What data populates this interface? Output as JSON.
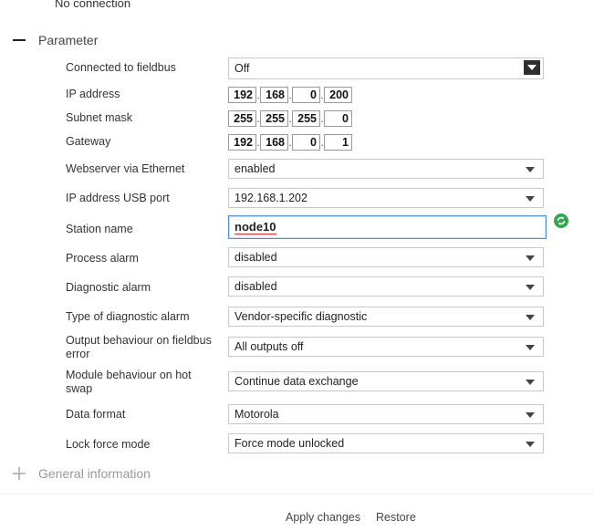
{
  "top_status": "No connection",
  "section_title": "Parameter",
  "collapsed_section": "General information",
  "params": {
    "connected_to_fieldbus": {
      "label": "Connected to fieldbus",
      "value": "Off"
    },
    "ip_address": {
      "label": "IP address",
      "octets": [
        "192",
        "168",
        "0",
        "200"
      ]
    },
    "subnet_mask": {
      "label": "Subnet mask",
      "octets": [
        "255",
        "255",
        "255",
        "0"
      ]
    },
    "gateway": {
      "label": "Gateway",
      "octets": [
        "192",
        "168",
        "0",
        "1"
      ]
    },
    "webserver": {
      "label": "Webserver via Ethernet",
      "value": "enabled"
    },
    "ip_usb": {
      "label": "IP address USB port",
      "value": "192.168.1.202"
    },
    "station_name": {
      "label": "Station name",
      "value": "node10"
    },
    "process_alarm": {
      "label": "Process alarm",
      "value": "disabled"
    },
    "diagnostic_alarm": {
      "label": "Diagnostic alarm",
      "value": "disabled"
    },
    "diag_type": {
      "label": "Type of diagnostic alarm",
      "value": "Vendor-specific diagnostic"
    },
    "output_behaviour": {
      "label": "Output behaviour on fieldbus error",
      "value": "All outputs off"
    },
    "module_behaviour": {
      "label": "Module behaviour on hot swap",
      "value": "Continue data exchange"
    },
    "data_format": {
      "label": "Data format",
      "value": "Motorola"
    },
    "lock_force": {
      "label": "Lock force mode",
      "value": "Force mode unlocked"
    }
  },
  "footer": {
    "apply_label": "Apply changes",
    "restore_label": "Restore"
  },
  "colors": {
    "refresh_icon": "#2fa84f",
    "focus_border": "#4a8fe0"
  }
}
